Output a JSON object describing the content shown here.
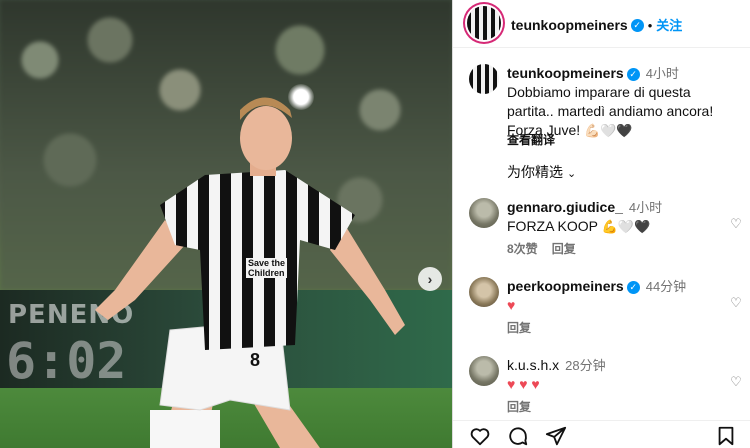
{
  "photo": {
    "board_text": "PENENO",
    "board_clock": "6:02",
    "jersey_sponsor_line1": "Save the",
    "jersey_sponsor_line2": "Children",
    "jersey_number": "8"
  },
  "header": {
    "username": "teunkoopmeiners",
    "separator": "•",
    "follow_label": "关注"
  },
  "caption": {
    "username": "teunkoopmeiners",
    "time": "4小时",
    "text_line1": "Dobbiamo imparare di questa",
    "text_line2": "partita.. martedì andiamo ancora!",
    "text_line3": "Forza Juve! ",
    "text_emojis": "💪🏻🤍🖤",
    "see_translation": "查看翻译"
  },
  "for_you": {
    "label": "为你精选",
    "chevron": "⌄"
  },
  "comments": [
    {
      "username": "gennaro.giudice_",
      "time": "4小时",
      "text": "FORZA KOOP",
      "emojis": "💪🤍🖤",
      "likes": "8次赞",
      "reply": "回复"
    },
    {
      "username": "peerkoopmeiners",
      "time": "44分钟",
      "text": "",
      "emojis": "♥",
      "likes": "",
      "reply": "回复"
    },
    {
      "username": "k.u.s.h.x",
      "time": "28分钟",
      "text": "",
      "emojis": "♥ ♥ ♥",
      "likes": "",
      "reply": "回复"
    }
  ],
  "colors": {
    "accent": "#0095f6",
    "heart": "#ed4956",
    "muted": "#737373"
  },
  "icons": [
    "verified-icon",
    "heart-outline-icon",
    "comment-icon",
    "share-icon",
    "bookmark-icon",
    "chevron-right-icon"
  ]
}
